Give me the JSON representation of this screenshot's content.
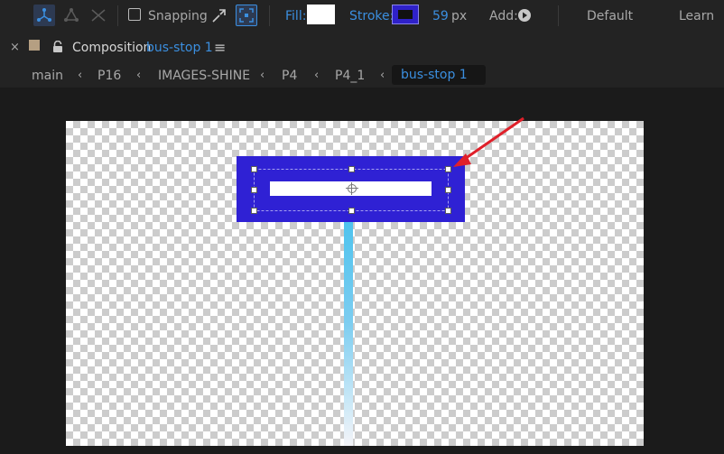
{
  "toolbar": {
    "tools": [
      {
        "icon": "puppet-pin-icon",
        "active": true
      },
      {
        "icon": "puppet-advanced-pin-icon",
        "active": false
      },
      {
        "icon": "puppet-bend-pin-icon",
        "active": false
      }
    ],
    "snapping": {
      "label": "Snapping",
      "checked": false
    },
    "fill": {
      "label": "Fill:",
      "color": "#ffffff"
    },
    "stroke": {
      "label": "Stroke:",
      "color": "#2f21c9",
      "width_value": "59",
      "width_unit": "px"
    },
    "add": {
      "label": "Add:"
    },
    "workspaces": [
      "Default",
      "Learn"
    ]
  },
  "panel": {
    "title_prefix": "Composition",
    "title_name": "bus-stop 1",
    "label_color": "#b59f82"
  },
  "breadcrumbs": {
    "items": [
      "main",
      "P16",
      "IMAGES-SHINE",
      "P4",
      "P4_1"
    ],
    "active": "bus-stop 1"
  },
  "composition": {
    "background": "transparency-grid",
    "sign_color": "#2f21d4",
    "sign_bar_color": "#ffffff",
    "pole_gradient": [
      "#4ec3ee",
      "#f4f4f8"
    ],
    "annotation_arrow_color": "#e0202a"
  }
}
